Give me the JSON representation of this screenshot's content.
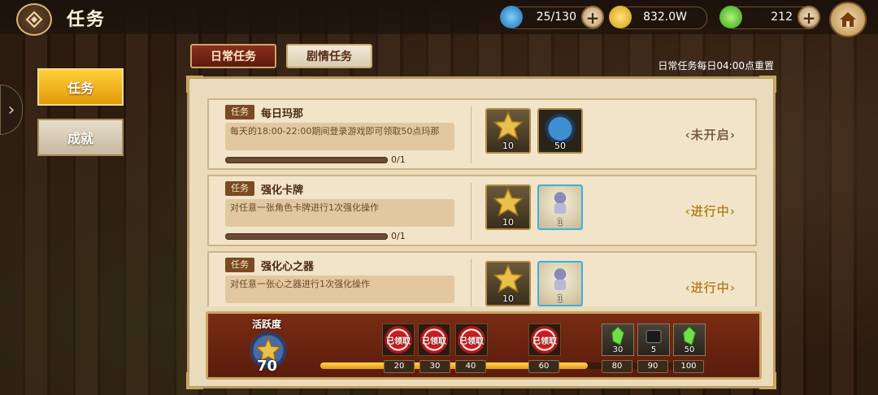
{
  "header": {
    "title": "任务",
    "stamina": "25/130",
    "gold": "832.0W",
    "gems": "212"
  },
  "sidebar": {
    "items": [
      {
        "label": "任务",
        "active": true
      },
      {
        "label": "成就",
        "active": false
      }
    ]
  },
  "tabs": [
    {
      "label": "日常任务",
      "active": true
    },
    {
      "label": "剧情任务",
      "active": false
    }
  ],
  "reset_note": "日常任务每日04:00点重置",
  "badge_label": "任务",
  "tasks": [
    {
      "name": "每日玛那",
      "desc": "每天的18:00-22:00期间登录游戏即可领取50点玛那",
      "progress": "0/1",
      "progress_fraction": 0,
      "rewards": [
        {
          "icon": "gold-star-icon",
          "count": "10"
        },
        {
          "icon": "mana-orb-icon",
          "count": "50"
        }
      ],
      "status": "未开启"
    },
    {
      "name": "强化卡牌",
      "desc": "对任意一张角色卡牌进行1次强化操作",
      "progress": "0/1",
      "progress_fraction": 0,
      "rewards": [
        {
          "icon": "gold-star-icon",
          "count": "10"
        },
        {
          "icon": "character-card-icon",
          "count": "1"
        }
      ],
      "status": "进行中"
    },
    {
      "name": "强化心之器",
      "desc": "对任意一张心之器进行1次强化操作",
      "progress": "",
      "progress_fraction": 0,
      "rewards": [
        {
          "icon": "gold-star-icon",
          "count": "10"
        },
        {
          "icon": "character-card-icon",
          "count": "1"
        }
      ],
      "status": "进行中"
    }
  ],
  "activity": {
    "label": "活跃度",
    "value": "70",
    "fill_fraction": 0.7,
    "claimed_text": "已领取",
    "milestones": [
      "20",
      "30",
      "40",
      "60",
      "80",
      "90",
      "100"
    ],
    "rewards": [
      {
        "icon": "green-gem-icon",
        "count": "30"
      },
      {
        "icon": "black-chest-icon",
        "count": "5"
      },
      {
        "icon": "green-gem-icon",
        "count": "50"
      }
    ]
  },
  "colors": {
    "accent_gold": "#e39a08",
    "panel": "#eadbbd",
    "activity_bg": "#7a2c14"
  }
}
